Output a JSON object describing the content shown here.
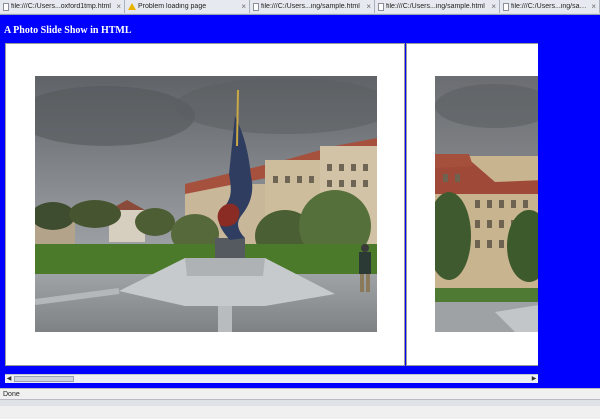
{
  "browser": {
    "tabs": [
      {
        "label": "file:///C:/Users...oxford1tmp.html",
        "icon": "page-icon"
      },
      {
        "label": "Problem loading page",
        "icon": "warning-icon"
      },
      {
        "label": "file:///C:/Users...ing/sample.html",
        "icon": "page-icon"
      },
      {
        "label": "file:///C:/Users...ing/sample.html",
        "icon": "page-icon"
      },
      {
        "label": "file:///C:/Users...ing/sample.html",
        "icon": "page-icon"
      }
    ],
    "status": "Done"
  },
  "page": {
    "title": "A Photo Slide Show in HTML",
    "background_color": "#0000ff",
    "slides": [
      {
        "alt": "Prague monument photo"
      },
      {
        "alt": "Prague buildings photo"
      }
    ]
  }
}
